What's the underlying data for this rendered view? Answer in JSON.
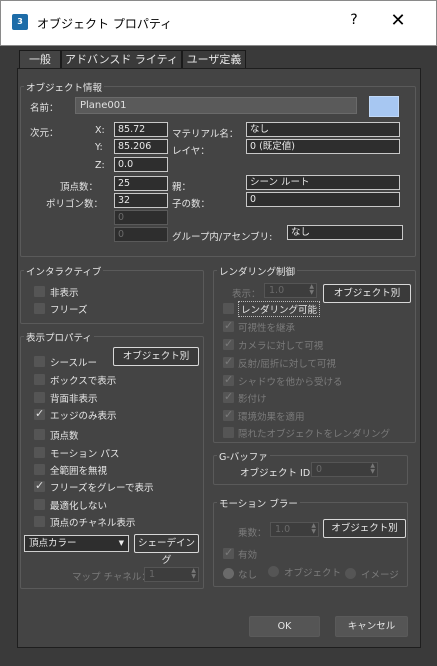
{
  "window": {
    "title": "オブジェクト プロパティ",
    "help": "?",
    "close": "✕",
    "app_icon": "3"
  },
  "tabs": [
    "一般",
    "アドバンスド ライティング",
    "ユーザ定義"
  ],
  "object_info": {
    "title": "オブジェクト情報",
    "name_label": "名前：",
    "name_value": "Plane001",
    "color": "#a7c7f2",
    "dims_label": "次元：",
    "x_label": "X:",
    "x_value": "85.72",
    "y_label": "Y:",
    "y_value": "85.206",
    "z_label": "Z:",
    "z_value": "0.0",
    "material_label": "マテリアル名：",
    "material_value": "なし",
    "layer_label": "レイヤ：",
    "layer_value": "0 (既定値)",
    "vertices_label": "頂点数：",
    "vertices_value": "25",
    "parent_label": "親：",
    "parent_value": "シーン ルート",
    "faces_label": "ポリゴン数：",
    "faces_value": "32",
    "children_label": "子の数：",
    "children_value": "0",
    "extra1": "0",
    "extra2": "0",
    "group_label": "グループ内/アセンブリ:",
    "group_value": "なし"
  },
  "interactivity": {
    "title": "インタラクティブ",
    "hide": "非表示",
    "freeze": "フリーズ"
  },
  "display": {
    "title": "表示プロパティ",
    "byobject": "オブジェクト別",
    "items": [
      {
        "label": "シースルー",
        "checked": false
      },
      {
        "label": "ボックスで表示",
        "checked": false
      },
      {
        "label": "背面非表示",
        "checked": false
      },
      {
        "label": "エッジのみ表示",
        "checked": true
      },
      {
        "label": "頂点数",
        "checked": false
      },
      {
        "label": "モーション パス",
        "checked": false
      },
      {
        "label": "全範囲を無視",
        "checked": false
      },
      {
        "label": "フリーズをグレーで表示",
        "checked": true
      },
      {
        "label": "最適化しない",
        "checked": false
      },
      {
        "label": "頂点のチャネル表示",
        "checked": false
      }
    ],
    "vertex_color": "頂点カラー",
    "dropdown_arrow": "▼",
    "shaded": "シェーデイング",
    "map_channel_label": "マップ チャネル：",
    "map_channel_value": "1"
  },
  "rendering": {
    "title": "レンダリング制御",
    "visibility_label": "表示：",
    "visibility_value": "1.0",
    "byobject": "オブジェクト別",
    "renderable": "レンダリング可能",
    "items": [
      {
        "label": "可視性を継承",
        "checked": true
      },
      {
        "label": "カメラに対して可視",
        "checked": true
      },
      {
        "label": "反射/屈折に対して可視",
        "checked": true
      },
      {
        "label": "シャドウを他から受ける",
        "checked": true
      },
      {
        "label": "影付け",
        "checked": true
      },
      {
        "label": "環境効果を適用",
        "checked": true
      },
      {
        "label": "隠れたオブジェクトをレンダリング",
        "checked": false
      }
    ]
  },
  "gbuffer": {
    "title": "G-バッファ",
    "id_label": "オブジェクト ID:",
    "id_value": "0"
  },
  "motion_blur": {
    "title": "モーション ブラー",
    "multiplier_label": "乗数：",
    "multiplier_value": "1.0",
    "byobject": "オブジェクト別",
    "enabled": "有効",
    "none": "なし",
    "object": "オブジェクト",
    "image": "イメージ"
  },
  "footer": {
    "ok": "OK",
    "cancel": "キャンセル"
  }
}
